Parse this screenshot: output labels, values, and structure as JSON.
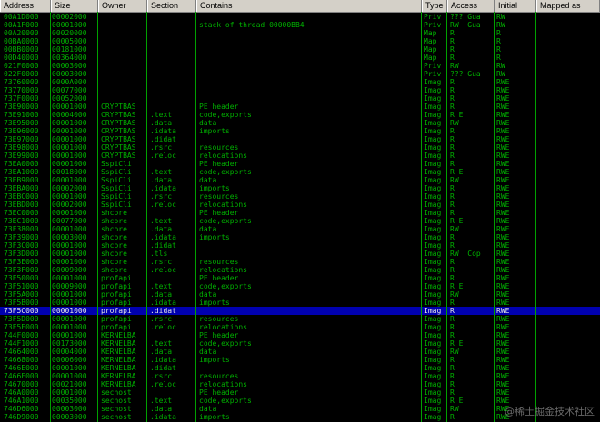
{
  "columns": [
    "Address",
    "Size",
    "Owner",
    "Section",
    "Contains",
    "Type",
    "Access",
    "Initial",
    "Mapped as"
  ],
  "selected_row": 36,
  "rows": [
    [
      "00A1D000",
      "00002000",
      "",
      "",
      "",
      "Priv",
      "??? Gua",
      "RW"
    ],
    [
      "00A1F000",
      "00001000",
      "",
      "",
      "stack of thread 00000BB4",
      "Priv",
      "RW  Gua",
      "RW"
    ],
    [
      "00A20000",
      "00020000",
      "",
      "",
      "",
      "Map",
      "R",
      "R"
    ],
    [
      "00BA0000",
      "00005000",
      "",
      "",
      "",
      "Map",
      "R",
      "R"
    ],
    [
      "00BB0000",
      "00181000",
      "",
      "",
      "",
      "Map",
      "R",
      "R"
    ],
    [
      "00D40000",
      "00364000",
      "",
      "",
      "",
      "Map",
      "R",
      "R"
    ],
    [
      "021F0000",
      "00003000",
      "",
      "",
      "",
      "Priv",
      "RW",
      "RW"
    ],
    [
      "022F0000",
      "00003000",
      "",
      "",
      "",
      "Priv",
      "??? Gua",
      "RW"
    ],
    [
      "73760000",
      "0000A000",
      "",
      "",
      "",
      "Imag",
      "R",
      "RWE"
    ],
    [
      "73770000",
      "00077000",
      "",
      "",
      "",
      "Imag",
      "R",
      "RWE"
    ],
    [
      "737F0000",
      "00052000",
      "",
      "",
      "",
      "Imag",
      "R",
      "RWE"
    ],
    [
      "73E90000",
      "00001000",
      "CRYPTBAS",
      "",
      "PE header",
      "Imag",
      "R",
      "RWE"
    ],
    [
      "73E91000",
      "00004000",
      "CRYPTBAS",
      ".text",
      "code,exports",
      "Imag",
      "R E",
      "RWE"
    ],
    [
      "73E95000",
      "00001000",
      "CRYPTBAS",
      ".data",
      "data",
      "Imag",
      "RW",
      "RWE"
    ],
    [
      "73E96000",
      "00001000",
      "CRYPTBAS",
      ".idata",
      "imports",
      "Imag",
      "R",
      "RWE"
    ],
    [
      "73E97000",
      "00001000",
      "CRYPTBAS",
      ".didat",
      "",
      "Imag",
      "R",
      "RWE"
    ],
    [
      "73E98000",
      "00001000",
      "CRYPTBAS",
      ".rsrc",
      "resources",
      "Imag",
      "R",
      "RWE"
    ],
    [
      "73E99000",
      "00001000",
      "CRYPTBAS",
      ".reloc",
      "relocations",
      "Imag",
      "R",
      "RWE"
    ],
    [
      "73EA0000",
      "00001000",
      "SspiCli",
      "",
      "PE header",
      "Imag",
      "R",
      "RWE"
    ],
    [
      "73EA1000",
      "00018000",
      "SspiCli",
      ".text",
      "code,exports",
      "Imag",
      "R E",
      "RWE"
    ],
    [
      "73EB9000",
      "00001000",
      "SspiCli",
      ".data",
      "data",
      "Imag",
      "RW",
      "RWE"
    ],
    [
      "73EBA000",
      "00002000",
      "SspiCli",
      ".idata",
      "imports",
      "Imag",
      "R",
      "RWE"
    ],
    [
      "73EBC000",
      "00001000",
      "SspiCli",
      ".rsrc",
      "resources",
      "Imag",
      "R",
      "RWE"
    ],
    [
      "73EBD000",
      "00002000",
      "SspiCli",
      ".reloc",
      "relocations",
      "Imag",
      "R",
      "RWE"
    ],
    [
      "73EC0000",
      "00001000",
      "shcore",
      "",
      "PE header",
      "Imag",
      "R",
      "RWE"
    ],
    [
      "73EC1000",
      "00077000",
      "shcore",
      ".text",
      "code,exports",
      "Imag",
      "R E",
      "RWE"
    ],
    [
      "73F38000",
      "00001000",
      "shcore",
      ".data",
      "data",
      "Imag",
      "RW",
      "RWE"
    ],
    [
      "73F39000",
      "00003000",
      "shcore",
      ".idata",
      "imports",
      "Imag",
      "R",
      "RWE"
    ],
    [
      "73F3C000",
      "00001000",
      "shcore",
      ".didat",
      "",
      "Imag",
      "R",
      "RWE"
    ],
    [
      "73F3D000",
      "00001000",
      "shcore",
      ".tls",
      "",
      "Imag",
      "RW  Cop",
      "RWE"
    ],
    [
      "73F3E000",
      "00001000",
      "shcore",
      ".rsrc",
      "resources",
      "Imag",
      "R",
      "RWE"
    ],
    [
      "73F3F000",
      "00009000",
      "shcore",
      ".reloc",
      "relocations",
      "Imag",
      "R",
      "RWE"
    ],
    [
      "73F50000",
      "00001000",
      "profapi",
      "",
      "PE header",
      "Imag",
      "R",
      "RWE"
    ],
    [
      "73F51000",
      "00009000",
      "profapi",
      ".text",
      "code,exports",
      "Imag",
      "R E",
      "RWE"
    ],
    [
      "73F5A000",
      "00001000",
      "profapi",
      ".data",
      "data",
      "Imag",
      "RW",
      "RWE"
    ],
    [
      "73F5B000",
      "00001000",
      "profapi",
      ".idata",
      "imports",
      "Imag",
      "R",
      "RWE"
    ],
    [
      "73F5C000",
      "00001000",
      "profapi",
      ".didat",
      "",
      "Imag",
      "R",
      "RWE"
    ],
    [
      "73F5D000",
      "00001000",
      "profapi",
      ".rsrc",
      "resources",
      "Imag",
      "R",
      "RWE"
    ],
    [
      "73F5E000",
      "00001000",
      "profapi",
      ".reloc",
      "relocations",
      "Imag",
      "R",
      "RWE"
    ],
    [
      "744F0000",
      "00001000",
      "KERNELBA",
      "",
      "PE header",
      "Imag",
      "R",
      "RWE"
    ],
    [
      "744F1000",
      "00173000",
      "KERNELBA",
      ".text",
      "code,exports",
      "Imag",
      "R E",
      "RWE"
    ],
    [
      "74664000",
      "00004000",
      "KERNELBA",
      ".data",
      "data",
      "Imag",
      "RW",
      "RWE"
    ],
    [
      "74668000",
      "00006000",
      "KERNELBA",
      ".idata",
      "imports",
      "Imag",
      "R",
      "RWE"
    ],
    [
      "7466E000",
      "00001000",
      "KERNELBA",
      ".didat",
      "",
      "Imag",
      "R",
      "RWE"
    ],
    [
      "7466F000",
      "00001000",
      "KERNELBA",
      ".rsrc",
      "resources",
      "Imag",
      "R",
      "RWE"
    ],
    [
      "74670000",
      "00021000",
      "KERNELBA",
      ".reloc",
      "relocations",
      "Imag",
      "R",
      "RWE"
    ],
    [
      "746A0000",
      "00001000",
      "sechost",
      "",
      "PE header",
      "Imag",
      "R",
      "RWE"
    ],
    [
      "746A1000",
      "00035000",
      "sechost",
      ".text",
      "code,exports",
      "Imag",
      "R E",
      "RWE"
    ],
    [
      "746D6000",
      "00003000",
      "sechost",
      ".data",
      "data",
      "Imag",
      "RW",
      "RWE"
    ],
    [
      "746D9000",
      "00003000",
      "sechost",
      ".idata",
      "imports",
      "Imag",
      "R",
      "RWE"
    ]
  ],
  "watermark": "@稀土掘金技术社区"
}
